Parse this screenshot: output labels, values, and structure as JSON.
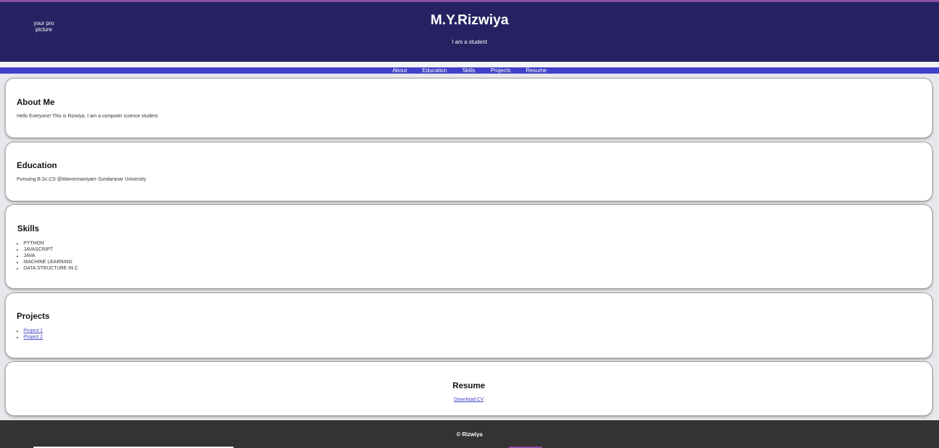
{
  "header": {
    "profile_alt_line1": "your pro",
    "profile_alt_line2": "picture",
    "title": "M.Y.Rizwiya",
    "subtitle": "I am a student"
  },
  "nav": {
    "items": [
      "About",
      "Education",
      "Skills",
      "Projects",
      "Resume"
    ]
  },
  "about": {
    "heading": "About Me",
    "text": "Hello Everyone! This is Rizwiya. I am a computer science student."
  },
  "education": {
    "heading": "Education",
    "text": "Pursuing B.Sc.CS @Manonmaniyam Sundaranar University"
  },
  "skills": {
    "heading": "Skills",
    "items": [
      "PYTHON",
      "JAVASCRIPT",
      "JAVA",
      "MACHINE LEARNING",
      "DATA STRUCTURE IN C"
    ]
  },
  "projects": {
    "heading": "Projects",
    "items": [
      "Project 1",
      "Project 2"
    ]
  },
  "resume": {
    "heading": "Resume",
    "link": "Download CV"
  },
  "footer": {
    "text": "© Rizwiya"
  },
  "colors": {
    "header_bg": "#262262",
    "nav_bg": "#4040c8",
    "footer_bg": "#333333",
    "accent": "#8a4fa3"
  }
}
